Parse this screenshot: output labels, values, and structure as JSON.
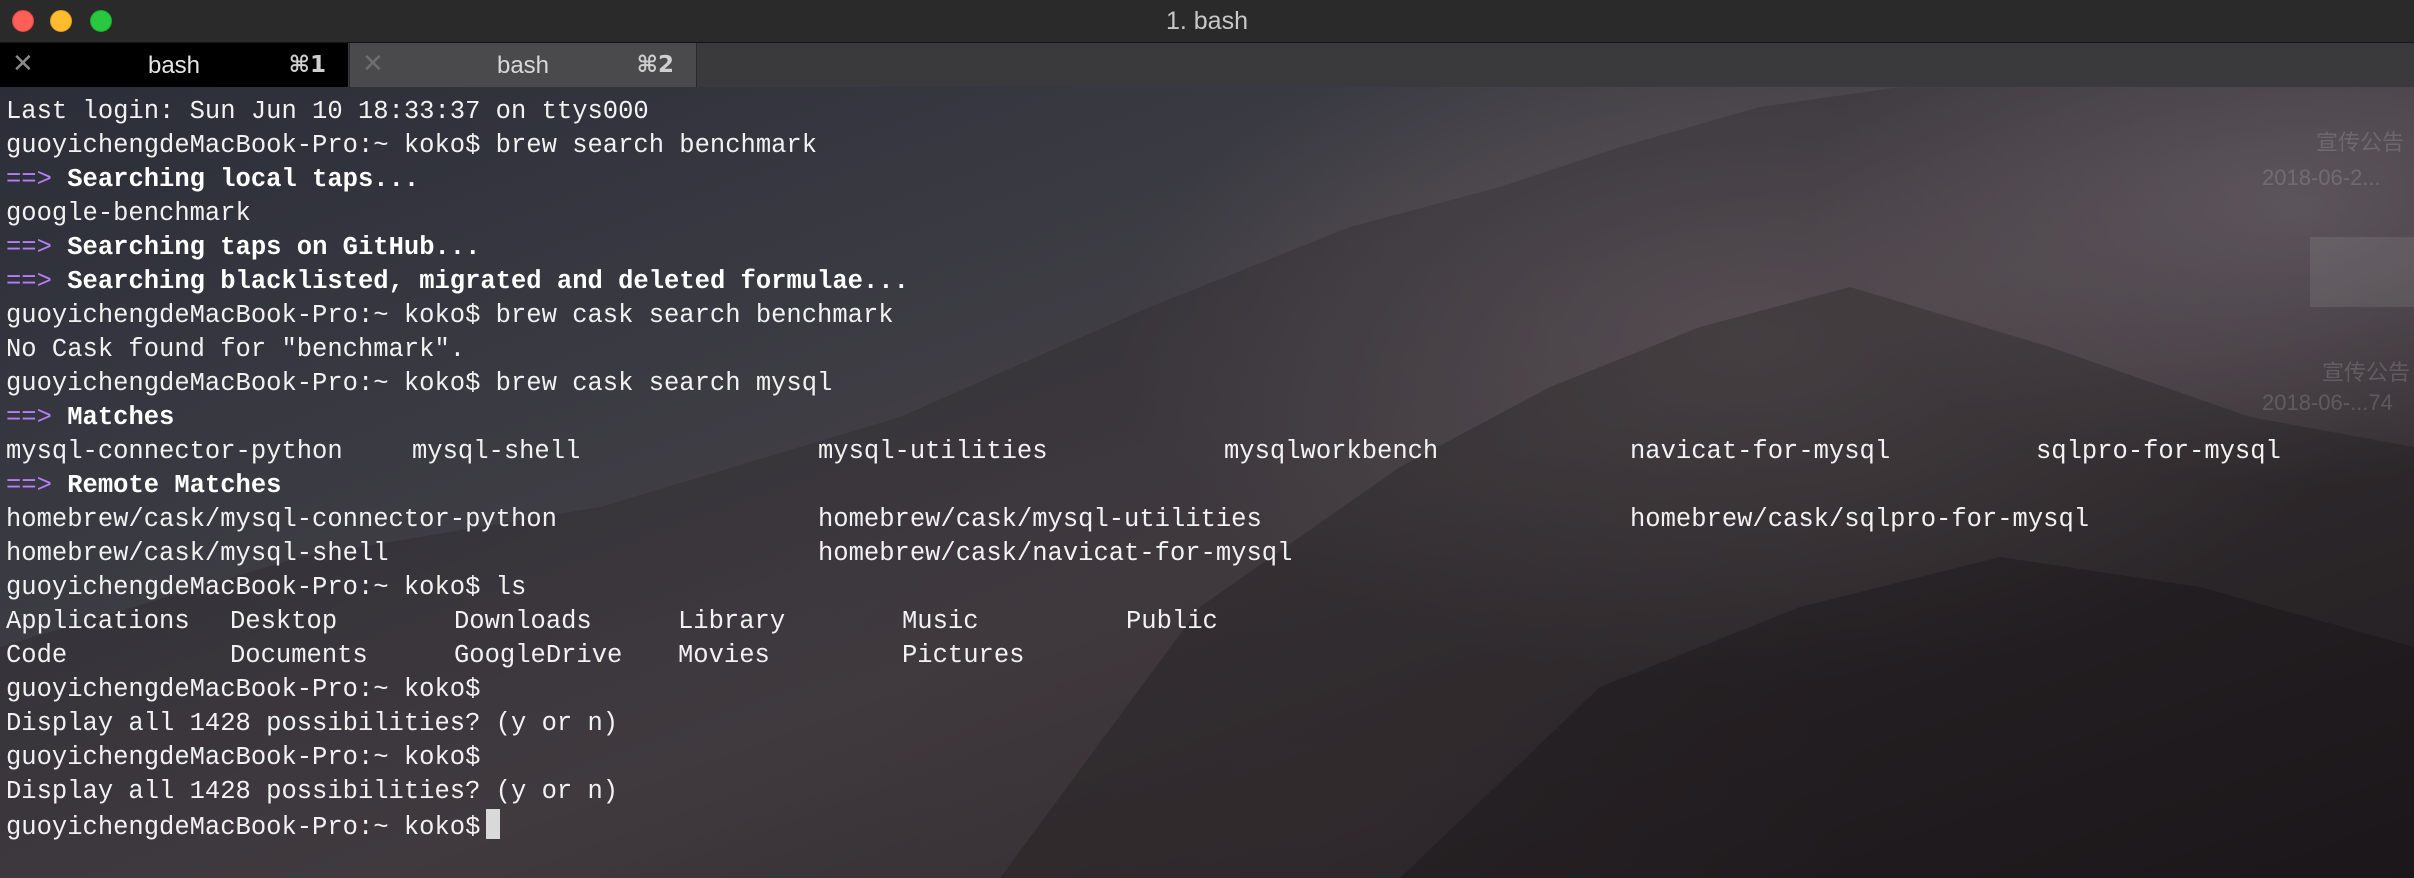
{
  "window": {
    "title": "1. bash"
  },
  "tabs": [
    {
      "close_glyph": "✕",
      "label": "bash",
      "shortcut": "⌘1",
      "active": true
    },
    {
      "close_glyph": "✕",
      "label": "bash",
      "shortcut": "⌘2",
      "active": false
    }
  ],
  "colors": {
    "arrow": "#b67ef7",
    "text": "#f2f2f2",
    "cursor": "#d9d9d9"
  },
  "terminal": {
    "arrow": "==>",
    "line_login": "Last login: Sun Jun 10 18:33:37 on ttys000",
    "cmd1": "guoyichengdeMacBook-Pro:~ koko$ brew search benchmark",
    "h_local_taps": "Searching local taps...",
    "out_google_benchmark": "google-benchmark",
    "h_taps_github": "Searching taps on GitHub...",
    "h_blacklisted": "Searching blacklisted, migrated and deleted formulae...",
    "cmd2": "guoyichengdeMacBook-Pro:~ koko$ brew cask search benchmark",
    "out_no_cask": "No Cask found for \"benchmark\".",
    "cmd3": "guoyichengdeMacBook-Pro:~ koko$ brew cask search mysql",
    "h_matches": "Matches",
    "matches": [
      "mysql-connector-python",
      "mysql-shell",
      "mysql-utilities",
      "mysqlworkbench",
      "navicat-for-mysql",
      "sqlpro-for-mysql"
    ],
    "h_remote_matches": "Remote Matches",
    "remote_row1": [
      "homebrew/cask/mysql-connector-python",
      "homebrew/cask/mysql-utilities",
      "homebrew/cask/sqlpro-for-mysql"
    ],
    "remote_row2": [
      "homebrew/cask/mysql-shell",
      "homebrew/cask/navicat-for-mysql"
    ],
    "cmd4": "guoyichengdeMacBook-Pro:~ koko$ ls",
    "ls_row1": [
      "Applications",
      "Desktop",
      "Downloads",
      "Library",
      "Music",
      "Public"
    ],
    "ls_row2": [
      "Code",
      "Documents",
      "GoogleDrive",
      "Movies",
      "Pictures"
    ],
    "prompt": "guoyichengdeMacBook-Pro:~ koko$",
    "display_all": "Display all 1428 possibilities? (y or n)"
  },
  "background_text": {
    "line1": "宣传公告",
    "line2": "2018-06-2...",
    "line3": "宣传公告",
    "line4": "2018-06-...74"
  }
}
